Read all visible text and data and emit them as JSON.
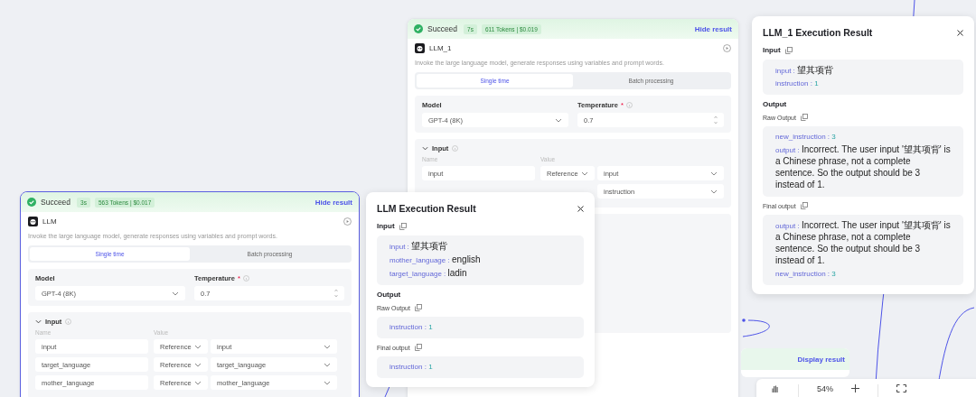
{
  "nodes": [
    {
      "selected": false,
      "status": "Succeed",
      "duration": "7s",
      "tokens": "611 Tokens | $0.019",
      "toggle": "Hide result",
      "title": "LLM_1",
      "description": "Invoke the large language model, generate responses using variables and prompt words.",
      "tabs": [
        {
          "label": "Single time",
          "selected": true
        },
        {
          "label": "Batch processing",
          "selected": false
        }
      ],
      "model_label": "Model",
      "model": "GPT-4 (8K)",
      "temperature_label": "Temperature",
      "required_mark": "*",
      "temperature": "0.7",
      "input_heading": "Input",
      "name_header": "Name",
      "value_header": "Value",
      "inputs": [
        {
          "name": "input",
          "type": "Reference",
          "value": "input"
        },
        {
          "value": "instruction"
        }
      ]
    },
    {
      "selected": true,
      "status": "Succeed",
      "duration": "3s",
      "tokens": "563 Tokens | $0.017",
      "toggle": "Hide result",
      "title": "LLM",
      "description": "Invoke the large language model, generate responses using variables and prompt words.",
      "tabs": [
        {
          "label": "Single time",
          "selected": true
        },
        {
          "label": "Batch processing",
          "selected": false
        }
      ],
      "model_label": "Model",
      "model": "GPT-4 (8K)",
      "temperature_label": "Temperature",
      "required_mark": "*",
      "temperature": "0.7",
      "input_heading": "Input",
      "name_header": "Name",
      "value_header": "Value",
      "inputs": [
        {
          "name": "input",
          "type": "Reference",
          "value": "input"
        },
        {
          "name": "target_language",
          "type": "Reference",
          "value": "target_language"
        },
        {
          "name": "mother_language",
          "type": "Reference",
          "value": "mother_language"
        }
      ]
    }
  ],
  "result_panels": [
    {
      "title": "LLM Execution Result",
      "input_heading": "Input",
      "input_items": [
        {
          "key": "input :",
          "value": "望其项背",
          "kind": "string"
        },
        {
          "key": "mother_language :",
          "value": "english",
          "kind": "string"
        },
        {
          "key": "target_language :",
          "value": "ladin",
          "kind": "string"
        }
      ],
      "output_heading": "Output",
      "raw_label": "Raw Output",
      "raw_items": [
        {
          "key": "instruction :",
          "value": "1",
          "kind": "number"
        }
      ],
      "final_label": "Final output",
      "final_items": [
        {
          "key": "instruction :",
          "value": "1",
          "kind": "number"
        }
      ]
    },
    {
      "title": "LLM_1 Execution Result",
      "input_heading": "Input",
      "input_items": [
        {
          "key": "input :",
          "value": "望其项背",
          "kind": "string"
        },
        {
          "key": "instruction :",
          "value": "1",
          "kind": "number"
        }
      ],
      "output_heading": "Output",
      "raw_label": "Raw Output",
      "raw_items": [
        {
          "key": "new_instruction :",
          "value": "3",
          "kind": "number"
        },
        {
          "key": "output :",
          "value": "Incorrect. The user input '望其项背' is a Chinese phrase, not a complete sentence. So the output should be 3 instead of 1.",
          "kind": "string"
        }
      ],
      "final_label": "Final output",
      "final_items": [
        {
          "key": "output :",
          "value": "Incorrect. The user input '望其项背' is a Chinese phrase, not a complete sentence. So the output should be 3 instead of 1.",
          "kind": "string"
        },
        {
          "key": "new_instruction :",
          "value": "3",
          "kind": "number"
        }
      ]
    }
  ],
  "display_node": {
    "toggle": "Display result"
  },
  "toolbar": {
    "zoom": "54%"
  }
}
